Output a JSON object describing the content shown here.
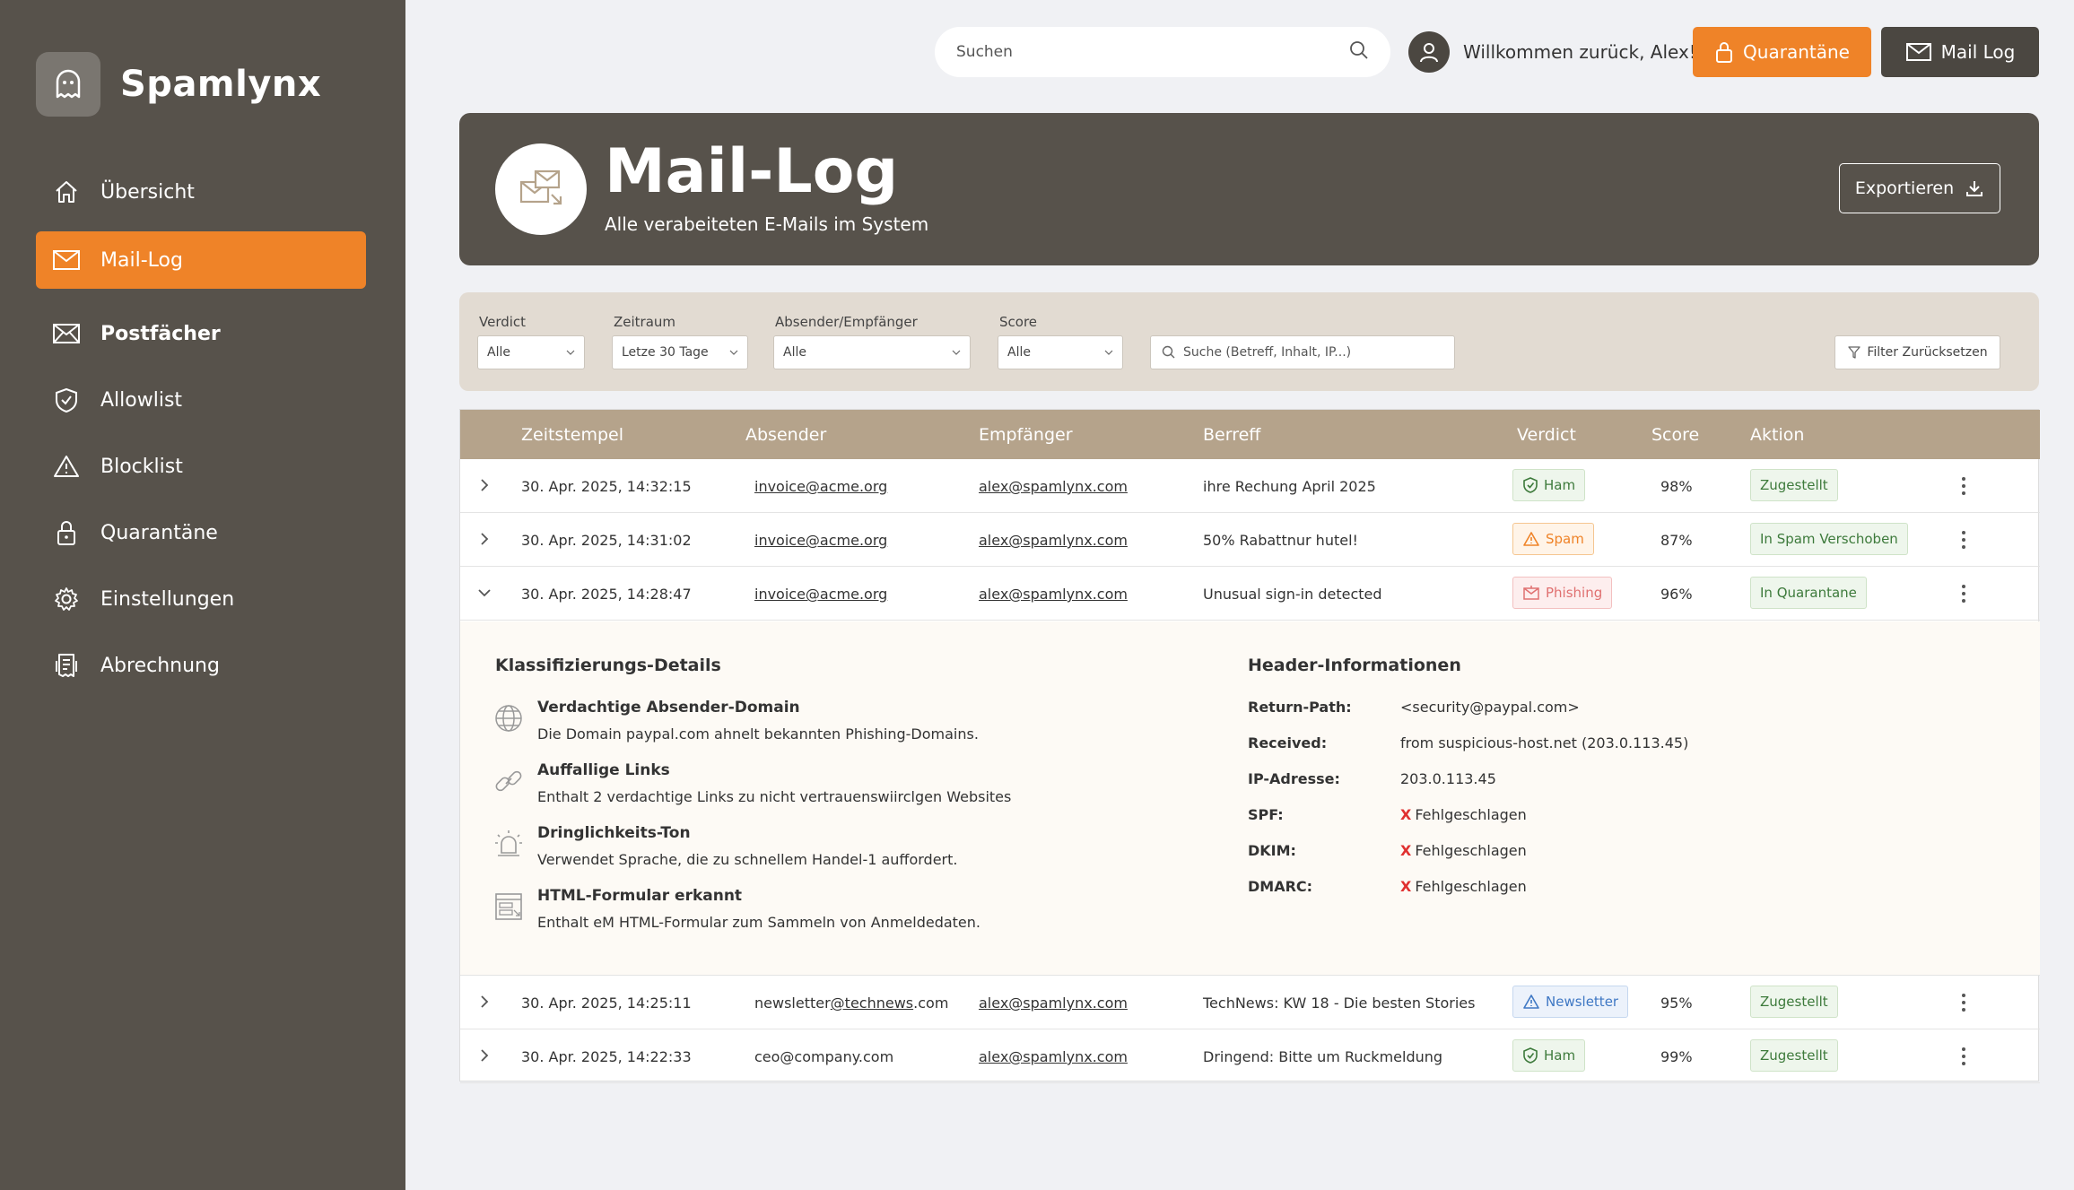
{
  "app": {
    "name": "Spamlynx"
  },
  "sidebar": {
    "items": [
      {
        "label": "Übersicht",
        "icon": "home-icon"
      },
      {
        "label": "Mail-Log",
        "icon": "mail-log-icon"
      },
      {
        "label": "Postfächer",
        "icon": "mailbox-icon"
      },
      {
        "label": "Allowlist",
        "icon": "shield-icon"
      },
      {
        "label": "Blocklist",
        "icon": "warning-icon"
      },
      {
        "label": "Quarantäne",
        "icon": "lock-icon"
      },
      {
        "label": "Einstellungen",
        "icon": "gear-icon"
      },
      {
        "label": "Abrechnung",
        "icon": "receipt-icon"
      }
    ],
    "active_index": 1
  },
  "topbar": {
    "search_placeholder": "Suchen",
    "welcome": "Willkommen zurück, Alex!",
    "quarantine_label": "Quarantäne",
    "maillog_label": "Mail Log"
  },
  "hero": {
    "title": "Mail-Log",
    "subtitle": "Alle verabeiteten E-Mails im System",
    "export_label": "Exportieren"
  },
  "filters": {
    "verdict": {
      "label": "Verdict",
      "value": "Alle"
    },
    "zeitraum": {
      "label": "Zeitraum",
      "value": "Letze 30 Tage"
    },
    "absender": {
      "label": "Absender/Empfänger",
      "value": "Alle"
    },
    "score": {
      "label": "Score",
      "value": "Alle"
    },
    "search_placeholder": "Suche (Betreff, Inhalt, IP...)",
    "reset_label": "Filter Zurücksetzen"
  },
  "table": {
    "headers": [
      "Zeitstempel",
      "Absender",
      "Empfänger",
      "Berreff",
      "Verdict",
      "Score",
      "Aktion"
    ],
    "rows": [
      {
        "time": "30. Apr. 2025,  14:32:15",
        "sender": "invoice@acme.org",
        "recipient": "alex@spamlynx.com",
        "subject": "ihre Rechung April 2025",
        "verdict": "Ham",
        "score": "98%",
        "action": "Zugestellt"
      },
      {
        "time": "30. Apr. 2025,  14:31:02",
        "sender": "invoice@acme.org",
        "recipient": "alex@spamlynx.com",
        "subject": "50% Rabattnur hutel!",
        "verdict": "Spam",
        "score": "87%",
        "action": "In Spam Verschoben"
      },
      {
        "time": "30. Apr. 2025,  14:28:47",
        "sender": "invoice@acme.org",
        "recipient": "alex@spamlynx.com",
        "subject": "Unusual sign-in detected",
        "verdict": "Phishing",
        "score": "96%",
        "action": "In Quarantane"
      },
      {
        "time": "30. Apr. 2025,  14:25:11",
        "sender_prefix": "newsletter",
        "sender_domain": "@technews",
        "sender_suffix": ".com",
        "recipient": "alex@spamlynx.com",
        "subject": "TechNews: KW 18 - Die besten Stories",
        "verdict": "Newsletter",
        "score": "95%",
        "action": "Zugestellt"
      },
      {
        "time": "30. Apr. 2025,  14:22:33",
        "sender": "ceo@company.com",
        "recipient": "alex@spamlynx.com",
        "subject": "Dringend: Bitte um Ruckmeldung",
        "verdict": "Ham",
        "score": "99%",
        "action": "Zugestellt"
      }
    ]
  },
  "detail": {
    "class_title": "Klassifizierungs-Details",
    "items": [
      {
        "title": "Verdachtige Absender-Domain",
        "text": "Die Domain paypal.com ahnelt bekannten Phishing-Domains.",
        "icon": "globe-icon"
      },
      {
        "title": "Auffallige Links",
        "text": "Enthalt 2 verdachtige Links zu nicht vertrauenswiirclgen Websites",
        "icon": "link-icon"
      },
      {
        "title": "Dringlichkeits-Ton",
        "text": "Verwendet Sprache, die zu schnellem Handel-1 auffordert.",
        "icon": "alarm-icon"
      },
      {
        "title": "HTML-Formular erkannt",
        "text": "Enthalt eM HTML-Formular zum Sammeln von Anmeldedaten.",
        "icon": "form-icon"
      }
    ],
    "header_title": "Header-Informationen",
    "headers": [
      {
        "key": "Return-Path:",
        "value": "<security@paypal.com>"
      },
      {
        "key": "Received:",
        "value": "from suspicious-host.net (203.0.113.45)"
      },
      {
        "key": "IP-Adresse:",
        "value": "203.0.113.45"
      },
      {
        "key": "SPF:",
        "mark": "X",
        "value": "Fehlgeschlagen"
      },
      {
        "key": "DKIM:",
        "mark": "X",
        "value": "Fehlgeschlagen"
      },
      {
        "key": "DMARC:",
        "mark": "X",
        "value": "Fehlgeschlagen"
      }
    ]
  },
  "colors": {
    "accent": "#ef8328",
    "dark": "#57524b",
    "table_header": "#b5a38b"
  }
}
